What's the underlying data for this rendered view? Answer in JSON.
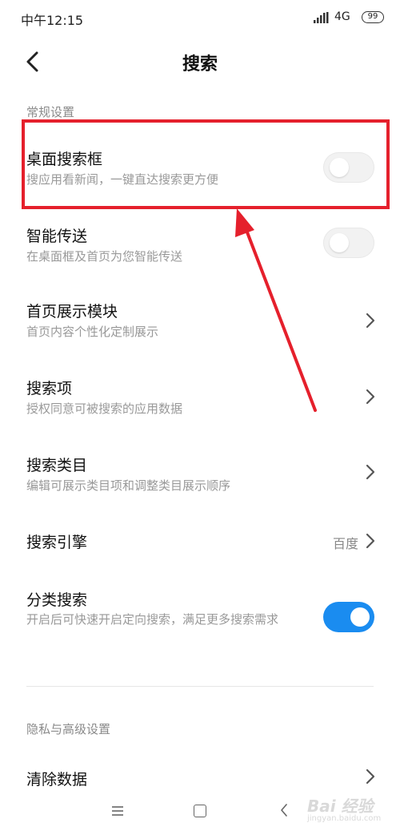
{
  "status_bar": {
    "time": "中午12:15",
    "network": "4G",
    "battery": "99"
  },
  "header": {
    "title": "搜索"
  },
  "sections": {
    "general": "常规设置",
    "privacy": "隐私与高级设置"
  },
  "settings": [
    {
      "title": "桌面搜索框",
      "subtitle": "搜应用看新闻，一键直达搜索更方便",
      "control": "toggle",
      "on": false
    },
    {
      "title": "智能传送",
      "subtitle": "在桌面框及首页为您智能传送",
      "control": "toggle",
      "on": false
    },
    {
      "title": "首页展示模块",
      "subtitle": "首页内容个性化定制展示",
      "control": "chevron"
    },
    {
      "title": "搜索项",
      "subtitle": "授权同意可被搜索的应用数据",
      "control": "chevron"
    },
    {
      "title": "搜索类目",
      "subtitle": "编辑可展示类目项和调整类目展示顺序",
      "control": "chevron"
    },
    {
      "title": "搜索引擎",
      "value": "百度",
      "control": "chevron"
    },
    {
      "title": "分类搜索",
      "subtitle": "开启后可快速开启定向搜索，满足更多搜索需求",
      "control": "toggle",
      "on": true
    }
  ],
  "privacy_items": [
    {
      "title": "清除数据",
      "control": "chevron"
    }
  ],
  "watermark": {
    "text": "Bai 经验",
    "url": "jingyan.baidu.com"
  },
  "colors": {
    "accent": "#1a8cf0",
    "annotation": "#e5202c"
  }
}
